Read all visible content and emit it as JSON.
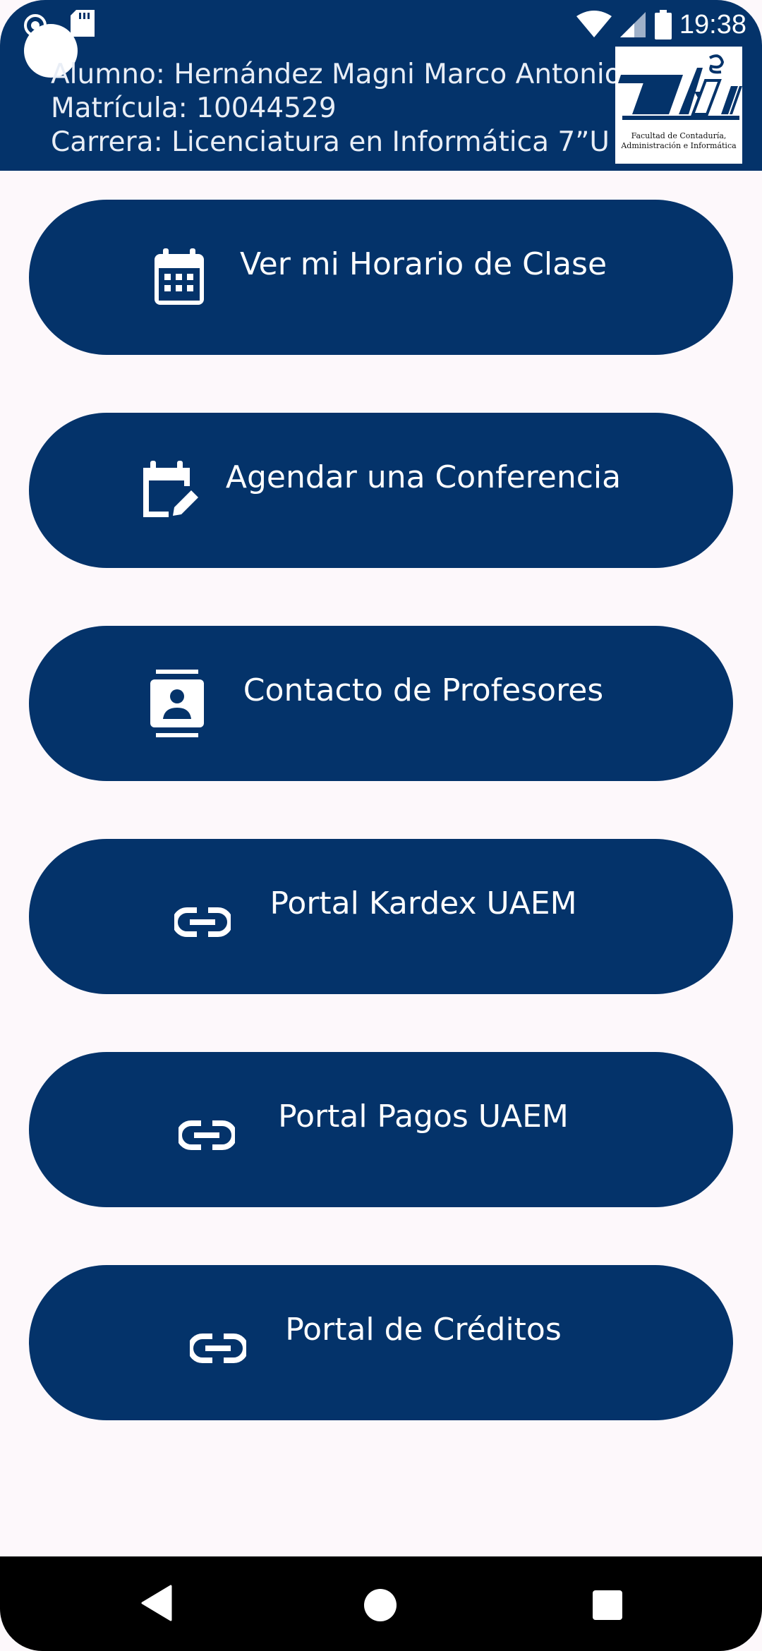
{
  "status_bar": {
    "time": "19:38",
    "icons": [
      "notification-icon",
      "sd-card-icon",
      "wifi-icon",
      "signal-icon",
      "battery-icon"
    ]
  },
  "header": {
    "student_line": "Alumno: Hernández Magni Marco Antonio",
    "id_line": "Matrícula: 10044529",
    "career_line": "Carrera: Licenciatura en Informática 7”U",
    "logo": {
      "caption_line1": "Facultad de Contaduría,",
      "caption_line2": "Administración e Informática"
    }
  },
  "menu": [
    {
      "label": "Ver mi Horario de Clase",
      "icon": "calendar-icon"
    },
    {
      "label": "Agendar una Conferencia",
      "icon": "calendar-edit-icon"
    },
    {
      "label": "Contacto de Profesores",
      "icon": "contacts-icon"
    },
    {
      "label": "Portal Kardex UAEM",
      "icon": "link-icon"
    },
    {
      "label": "Portal Pagos UAEM",
      "icon": "link-icon"
    },
    {
      "label": "Portal de Créditos",
      "icon": "link-icon"
    }
  ],
  "navigation": [
    "back-icon",
    "home-icon",
    "recents-icon"
  ],
  "colors": {
    "primary": "#04336a",
    "background": "#fdf8fb",
    "on_primary": "#ffffff"
  }
}
